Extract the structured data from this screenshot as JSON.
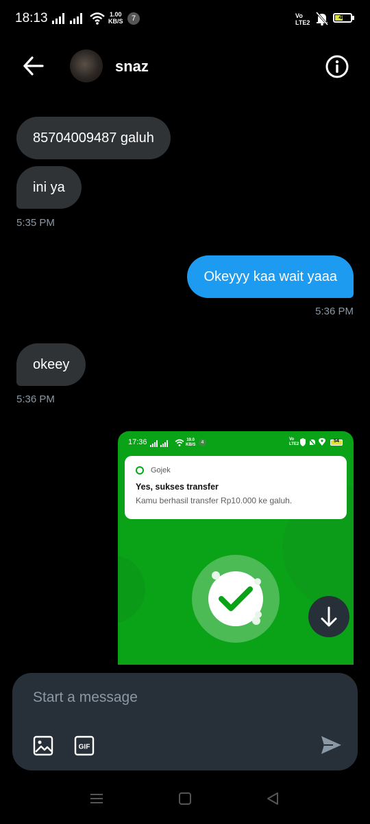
{
  "status_bar": {
    "time": "18:13",
    "speed_value": "1.00",
    "speed_unit": "KB/S",
    "notification_count": "7",
    "volte": "Vo",
    "lte": "LTE2",
    "battery": "47"
  },
  "header": {
    "contact_name": "snaz"
  },
  "messages": [
    {
      "text": "85704009487 galuh",
      "direction": "incoming"
    },
    {
      "text": "ini ya",
      "direction": "incoming"
    },
    {
      "time": "5:35 PM"
    },
    {
      "text": "Okeyyy kaa wait yaaa",
      "direction": "outgoing"
    },
    {
      "time": "5:36 PM"
    },
    {
      "text": "okeey",
      "direction": "incoming"
    },
    {
      "time": "5:36 PM"
    }
  ],
  "screenshot": {
    "time": "17:36",
    "speed_value": "19.0",
    "speed_unit": "KB/S",
    "notif_count": "4",
    "volte": "Vo",
    "lte": "LTE2",
    "battery": "54",
    "app_name": "Gojek",
    "notif_title": "Yes, sukses transfer",
    "notif_body": "Kamu berhasil transfer Rp10.000 ke galuh.",
    "bg_color": "#0aa317"
  },
  "composer": {
    "placeholder": "Start a message"
  },
  "icons": [
    "arrow-left-icon",
    "info-icon",
    "image-icon",
    "gif-icon",
    "send-icon",
    "arrow-down-icon",
    "menu-icon",
    "home-icon",
    "back-triangle-icon"
  ],
  "colors": {
    "outgoing": "#1d9bf0",
    "incoming": "#2f3336",
    "composer": "#273038"
  }
}
